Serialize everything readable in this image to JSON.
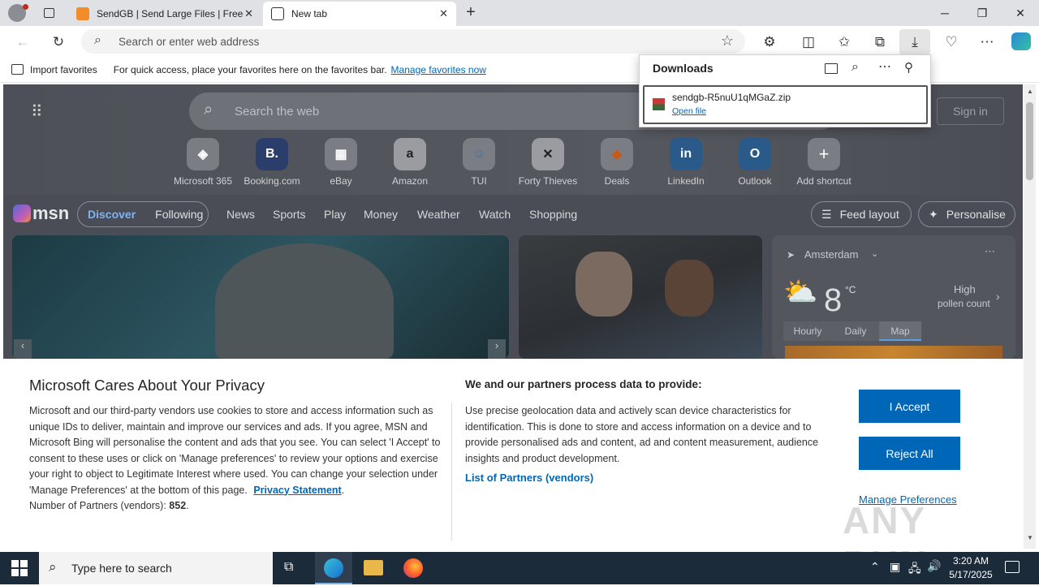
{
  "browser": {
    "tabs": [
      {
        "label": "SendGB | Send Large Files | Free f"
      },
      {
        "label": "New tab"
      }
    ],
    "address_placeholder": "Search or enter web address",
    "favorites_bar": {
      "import_label": "Import favorites",
      "hint": "For quick access, place your favorites here on the favorites bar.",
      "manage_link": "Manage favorites now"
    }
  },
  "downloads": {
    "title": "Downloads",
    "file_name": "sendgb-R5nuU1qMGaZ.zip",
    "open_label": "Open file"
  },
  "newtab": {
    "search_placeholder": "Search the web",
    "sign_in": "Sign in",
    "shortcuts": [
      {
        "label": "Microsoft 365",
        "glyph": "◈"
      },
      {
        "label": "Booking.com",
        "glyph": "B."
      },
      {
        "label": "eBay",
        "glyph": "▦"
      },
      {
        "label": "Amazon",
        "glyph": "a"
      },
      {
        "label": "TUI",
        "glyph": "☺"
      },
      {
        "label": "Forty Thieves",
        "glyph": "✕"
      },
      {
        "label": "Deals",
        "glyph": "◆"
      },
      {
        "label": "LinkedIn",
        "glyph": "in"
      },
      {
        "label": "Outlook",
        "glyph": "O"
      },
      {
        "label": "Add shortcut",
        "glyph": "+"
      }
    ],
    "msn": {
      "logo": "msn",
      "discover": "Discover",
      "following": "Following",
      "nav": [
        "News",
        "Sports",
        "Play",
        "Money",
        "Weather",
        "Watch",
        "Shopping"
      ],
      "feed_layout": "Feed layout",
      "personalise": "Personalise"
    },
    "weather": {
      "location": "Amsterdam",
      "temp": "8",
      "unit": "°C",
      "pollen_line1": "High",
      "pollen_line2": "pollen count",
      "tabs": [
        "Hourly",
        "Daily",
        "Map"
      ]
    }
  },
  "privacy": {
    "title": "Microsoft Cares About Your Privacy",
    "body": "Microsoft and our third-party vendors use cookies to store and access information such as unique IDs to deliver, maintain and improve our services and ads. If you agree, MSN and Microsoft Bing will personalise the content and ads that you see. You can select 'I Accept' to consent to these uses or click on 'Manage preferences' to review your options and exercise your right to object to Legitimate Interest where used.  You can change your selection under 'Manage Preferences' at the bottom of this page.",
    "statement_link": "Privacy Statement",
    "partners_label": "Number of Partners (vendors): ",
    "partners_count": "852",
    "process_title": "We and our partners process data to provide:",
    "process_body": "Use precise geolocation data and actively scan device characteristics for identification. This is done to store and access information on a device and to provide personalised ads and content, ad and content measurement, audience insights and product development.",
    "list_link": "List of Partners (vendors)",
    "accept": "I Accept",
    "reject": "Reject All",
    "manage": "Manage Preferences"
  },
  "taskbar": {
    "search_placeholder": "Type here to search",
    "time": "3:20 AM",
    "date": "5/17/2025"
  },
  "watermark": "ANY RUN"
}
